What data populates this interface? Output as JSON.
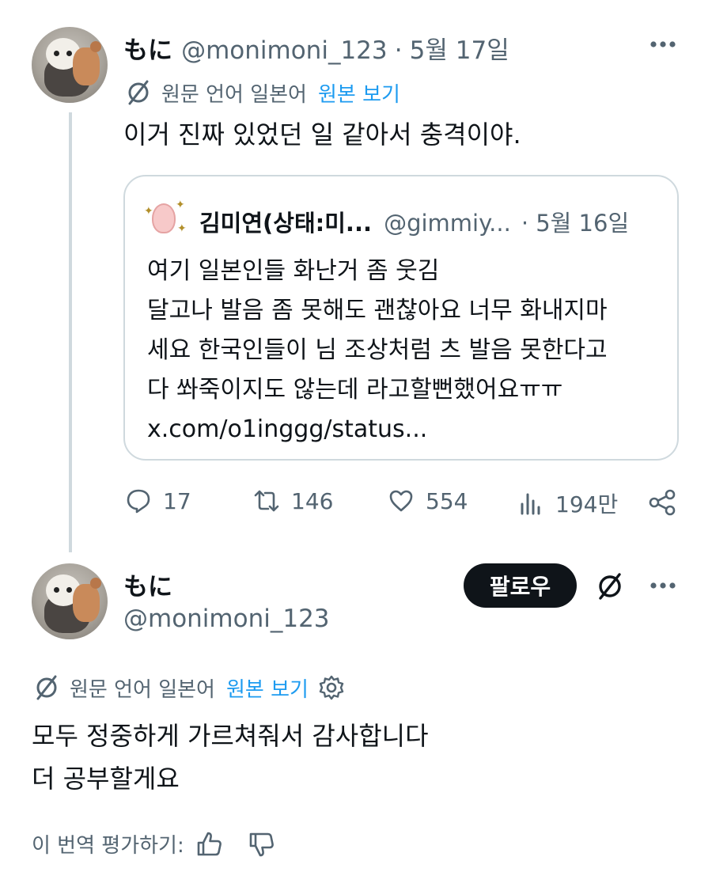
{
  "tweet1": {
    "display_name": "もに",
    "handle": "@monimoni_123",
    "separator": "·",
    "date": "5월 17일",
    "translation_label": "원문 언어 일본어",
    "show_original": "원본 보기",
    "text": "이거 진짜 있었던 일 같아서 충격이야.",
    "quote": {
      "display_name": "김미연(상태:미...",
      "handle": "@gimmiy...",
      "separator": "·",
      "date": "5월 16일",
      "lines": [
        "여기 일본인들 화난거 좀 웃김",
        "달고나 발음 좀 못해도 괜찮아요 너무 화내지마",
        "세요 한국인들이 님 조상처럼 츠 발음 못한다고",
        "다 쏴죽이지도 않는데 라고할뻔했어요ㅠㅠ",
        "x.com/o1inggg/status..."
      ]
    },
    "actions": {
      "replies": "17",
      "retweets": "146",
      "likes": "554",
      "views": "194만"
    }
  },
  "tweet2": {
    "display_name": "もに",
    "handle": "@monimoni_123",
    "follow_label": "팔로우",
    "translation_label": "원문 언어 일본어",
    "show_original": "원본 보기",
    "text_line1": "모두 정중하게 가르쳐줘서 감사합니다",
    "text_line2": "더 공부할게요",
    "rate_label": "이 번역 평가하기:"
  },
  "icons": [
    "translate-icon",
    "more-icon",
    "reply-icon",
    "retweet-icon",
    "like-icon",
    "views-icon",
    "share-icon",
    "settings-icon",
    "thumbs-up-icon",
    "thumbs-down-icon"
  ],
  "colors": {
    "accent": "#1d9bf0",
    "text": "#0f1419",
    "secondary": "#536471",
    "border": "#cfd9de"
  }
}
